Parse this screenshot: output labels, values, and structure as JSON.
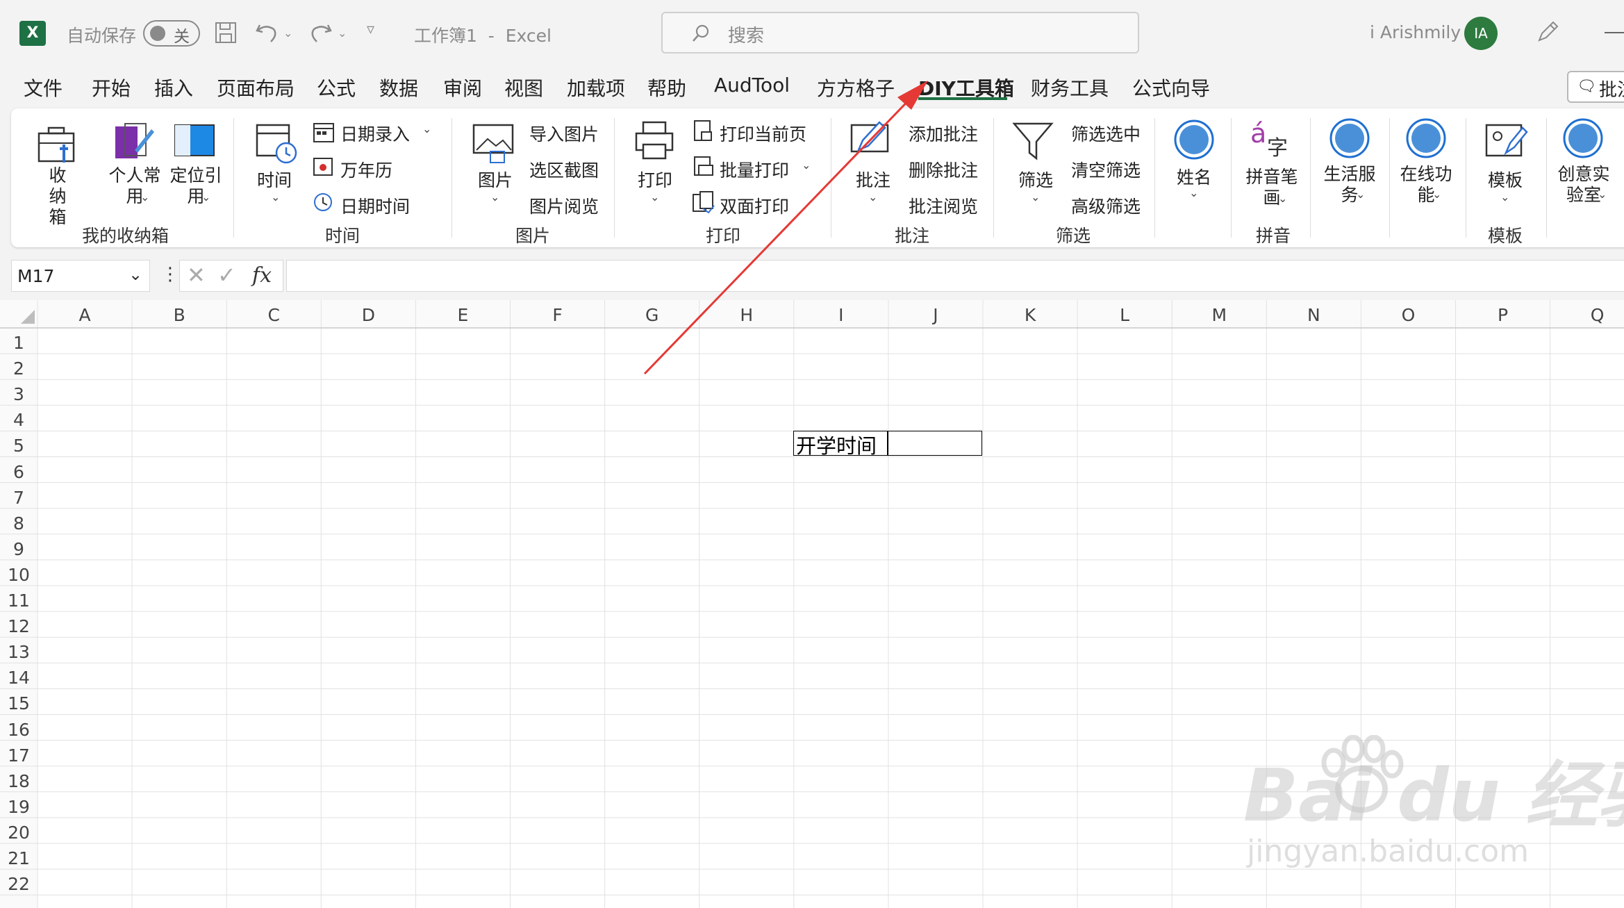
{
  "titlebar": {
    "autosave_label": "自动保存",
    "autosave_state": "关",
    "title": "工作簿1  -  Excel",
    "search_placeholder": "搜索",
    "user_name": "i Arishmily",
    "avatar_initials": "IA"
  },
  "menu": {
    "items": [
      "文件",
      "开始",
      "插入",
      "页面布局",
      "公式",
      "数据",
      "审阅",
      "视图",
      "加载项",
      "帮助",
      "AudTool",
      "方方格子",
      "DIY工具箱",
      "财务工具",
      "公式向导"
    ],
    "active_index": 12,
    "comment_button": "批注"
  },
  "ribbon": {
    "groups": {
      "collection": "我的收纳箱",
      "time": "时间",
      "picture": "图片",
      "print": "打印",
      "comment": "批注",
      "filter": "筛选",
      "pinyin": "拼音",
      "template": "模板"
    },
    "buttons": {
      "collect": "收纳箱",
      "personal": "个人常用",
      "locate": "定位引用",
      "time": "时间",
      "date_entry": "日期录入",
      "calendar": "万年历",
      "datetime": "日期时间",
      "picture": "图片",
      "import_picture": "导入图片",
      "screenshot": "选区截图",
      "picture_view": "图片阅览",
      "print": "打印",
      "print_current": "打印当前页",
      "batch_print": "批量打印",
      "duplex_print": "双面打印",
      "comment": "批注",
      "add_comment": "添加批注",
      "delete_comment": "删除批注",
      "comment_view": "批注阅览",
      "filter": "筛选",
      "filter_selected": "筛选选中",
      "clear_filter": "清空筛选",
      "advanced_filter": "高级筛选",
      "name": "姓名",
      "pinyin_stroke": "拼音笔画",
      "life_service": "生活服务",
      "online_func": "在线功能",
      "template": "模板",
      "creative_lab": "创意实验室"
    }
  },
  "formula_bar": {
    "name_box": "M17",
    "fx": "fx",
    "value": ""
  },
  "sheet": {
    "columns": [
      "A",
      "B",
      "C",
      "D",
      "E",
      "F",
      "G",
      "H",
      "I",
      "J",
      "K",
      "L",
      "M",
      "N",
      "O",
      "P",
      "Q"
    ],
    "rows": [
      "1",
      "2",
      "3",
      "4",
      "5",
      "6",
      "7",
      "8",
      "9",
      "10",
      "11",
      "12",
      "13",
      "14",
      "15",
      "16",
      "17",
      "18",
      "19",
      "20",
      "21",
      "22"
    ],
    "cell_I5": "开学时间",
    "cell_J5": ""
  },
  "watermark": {
    "brand": "Bai du 经验",
    "url": "jingyan.baidu.com"
  },
  "colors": {
    "excel_green": "#1e7145",
    "arrow_red": "#e53935",
    "highlight_blue": "#4a90d9"
  }
}
